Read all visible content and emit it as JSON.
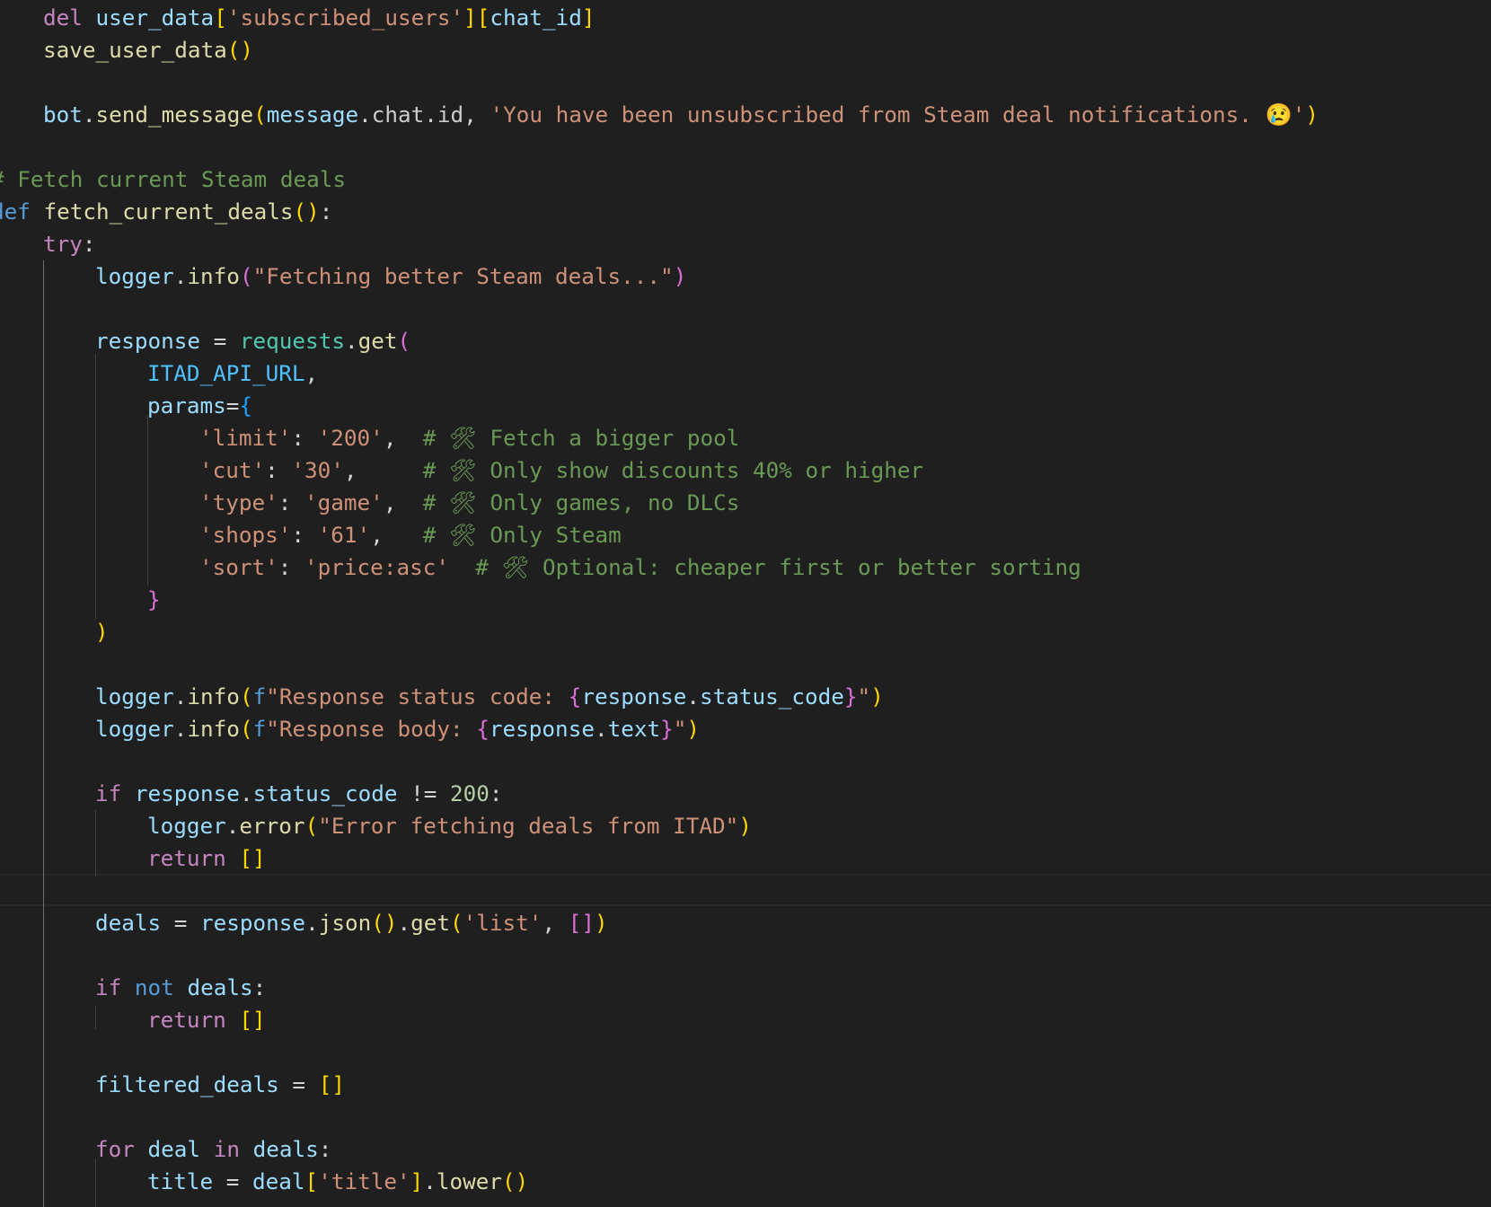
{
  "lines": [
    [
      [
        "k",
        "del"
      ],
      [
        "t",
        " "
      ],
      [
        "v",
        "user_data"
      ],
      [
        "p1",
        "["
      ],
      [
        "s",
        "'subscribed_users'"
      ],
      [
        "p1",
        "]"
      ],
      [
        "p1",
        "["
      ],
      [
        "v",
        "chat_id"
      ],
      [
        "p1",
        "]"
      ]
    ],
    [
      [
        "f",
        "save_user_data"
      ],
      [
        "p1",
        "()"
      ]
    ],
    [],
    [
      [
        "v",
        "bot"
      ],
      [
        "o",
        "."
      ],
      [
        "f",
        "send_message"
      ],
      [
        "p1",
        "("
      ],
      [
        "v",
        "message"
      ],
      [
        "o",
        "."
      ],
      [
        "t",
        "chat"
      ],
      [
        "o",
        "."
      ],
      [
        "t",
        "id"
      ],
      [
        "o",
        ", "
      ],
      [
        "s",
        "'You have been unsubscribed from Steam deal notifications. 😢'"
      ],
      [
        "p1",
        ")"
      ]
    ],
    [],
    [
      [
        "c",
        "# Fetch current Steam deals"
      ]
    ],
    [
      [
        "d",
        "def"
      ],
      [
        "t",
        " "
      ],
      [
        "f",
        "fetch_current_deals"
      ],
      [
        "p1",
        "()"
      ],
      [
        "o",
        ":"
      ]
    ],
    [
      [
        "k",
        "try"
      ],
      [
        "o",
        ":"
      ]
    ],
    [
      [
        "v",
        "logger"
      ],
      [
        "o",
        "."
      ],
      [
        "f",
        "info"
      ],
      [
        "p2",
        "("
      ],
      [
        "s",
        "\"Fetching better Steam deals...\""
      ],
      [
        "p2",
        ")"
      ]
    ],
    [],
    [
      [
        "v",
        "response"
      ],
      [
        "o",
        " = "
      ],
      [
        "m",
        "requests"
      ],
      [
        "o",
        "."
      ],
      [
        "f",
        "get"
      ],
      [
        "p2",
        "("
      ]
    ],
    [
      [
        "x",
        "ITAD_API_URL"
      ],
      [
        "o",
        ","
      ]
    ],
    [
      [
        "v",
        "params"
      ],
      [
        "o",
        "="
      ],
      [
        "p3",
        "{"
      ]
    ],
    [
      [
        "s",
        "'limit'"
      ],
      [
        "o",
        ": "
      ],
      [
        "s",
        "'200'"
      ],
      [
        "o",
        ",  "
      ],
      [
        "c",
        "# 🛠 Fetch a bigger pool"
      ]
    ],
    [
      [
        "s",
        "'cut'"
      ],
      [
        "o",
        ": "
      ],
      [
        "s",
        "'30'"
      ],
      [
        "o",
        ",     "
      ],
      [
        "c",
        "# 🛠 Only show discounts 40% or higher"
      ]
    ],
    [
      [
        "s",
        "'type'"
      ],
      [
        "o",
        ": "
      ],
      [
        "s",
        "'game'"
      ],
      [
        "o",
        ",  "
      ],
      [
        "c",
        "# 🛠 Only games, no DLCs"
      ]
    ],
    [
      [
        "s",
        "'shops'"
      ],
      [
        "o",
        ": "
      ],
      [
        "s",
        "'61'"
      ],
      [
        "o",
        ",   "
      ],
      [
        "c",
        "# 🛠 Only Steam"
      ]
    ],
    [
      [
        "s",
        "'sort'"
      ],
      [
        "o",
        ": "
      ],
      [
        "s",
        "'price:asc'"
      ],
      [
        "o",
        "  "
      ],
      [
        "c",
        "# 🛠 Optional: cheaper first or better sorting"
      ]
    ],
    [
      [
        "p2",
        "}"
      ]
    ],
    [
      [
        "p1",
        ")"
      ]
    ],
    [],
    [
      [
        "v",
        "logger"
      ],
      [
        "o",
        "."
      ],
      [
        "f",
        "info"
      ],
      [
        "p1",
        "("
      ],
      [
        "d",
        "f"
      ],
      [
        "s",
        "\"Response status code: "
      ],
      [
        "p2",
        "{"
      ],
      [
        "v",
        "response"
      ],
      [
        "o",
        "."
      ],
      [
        "v",
        "status_code"
      ],
      [
        "p2",
        "}"
      ],
      [
        "s",
        "\""
      ],
      [
        "p1",
        ")"
      ]
    ],
    [
      [
        "v",
        "logger"
      ],
      [
        "o",
        "."
      ],
      [
        "f",
        "info"
      ],
      [
        "p1",
        "("
      ],
      [
        "d",
        "f"
      ],
      [
        "s",
        "\"Response body: "
      ],
      [
        "p2",
        "{"
      ],
      [
        "v",
        "response"
      ],
      [
        "o",
        "."
      ],
      [
        "v",
        "text"
      ],
      [
        "p2",
        "}"
      ],
      [
        "s",
        "\""
      ],
      [
        "p1",
        ")"
      ]
    ],
    [],
    [
      [
        "k",
        "if"
      ],
      [
        "t",
        " "
      ],
      [
        "v",
        "response"
      ],
      [
        "o",
        "."
      ],
      [
        "v",
        "status_code"
      ],
      [
        "o",
        " != "
      ],
      [
        "n",
        "200"
      ],
      [
        "o",
        ":"
      ]
    ],
    [
      [
        "v",
        "logger"
      ],
      [
        "o",
        "."
      ],
      [
        "f",
        "error"
      ],
      [
        "p1",
        "("
      ],
      [
        "s",
        "\"Error fetching deals from ITAD\""
      ],
      [
        "p1",
        ")"
      ]
    ],
    [
      [
        "k",
        "return"
      ],
      [
        "t",
        " "
      ],
      [
        "p1",
        "[]"
      ]
    ],
    [],
    [
      [
        "v",
        "deals"
      ],
      [
        "o",
        " = "
      ],
      [
        "v",
        "response"
      ],
      [
        "o",
        "."
      ],
      [
        "f",
        "json"
      ],
      [
        "p1",
        "()"
      ],
      [
        "o",
        "."
      ],
      [
        "f",
        "get"
      ],
      [
        "p1",
        "("
      ],
      [
        "s",
        "'list'"
      ],
      [
        "o",
        ", "
      ],
      [
        "p2",
        "[]"
      ],
      [
        "p1",
        ")"
      ]
    ],
    [],
    [
      [
        "k",
        "if"
      ],
      [
        "t",
        " "
      ],
      [
        "d",
        "not"
      ],
      [
        "t",
        " "
      ],
      [
        "v",
        "deals"
      ],
      [
        "o",
        ":"
      ]
    ],
    [
      [
        "k",
        "return"
      ],
      [
        "t",
        " "
      ],
      [
        "p1",
        "[]"
      ]
    ],
    [],
    [
      [
        "v",
        "filtered_deals"
      ],
      [
        "o",
        " = "
      ],
      [
        "p1",
        "[]"
      ]
    ],
    [],
    [
      [
        "k",
        "for"
      ],
      [
        "t",
        " "
      ],
      [
        "v",
        "deal"
      ],
      [
        "t",
        " "
      ],
      [
        "k",
        "in"
      ],
      [
        "t",
        " "
      ],
      [
        "v",
        "deals"
      ],
      [
        "o",
        ":"
      ]
    ],
    [
      [
        "v",
        "title"
      ],
      [
        "o",
        " = "
      ],
      [
        "v",
        "deal"
      ],
      [
        "p1",
        "["
      ],
      [
        "s",
        "'title'"
      ],
      [
        "p1",
        "]"
      ],
      [
        "o",
        "."
      ],
      [
        "f",
        "lower"
      ],
      [
        "p1",
        "()"
      ]
    ]
  ]
}
